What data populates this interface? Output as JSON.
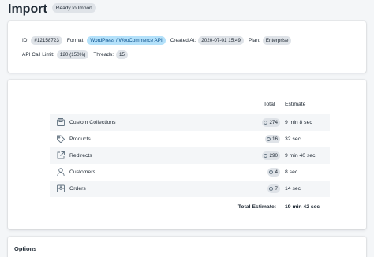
{
  "header": {
    "title": "Import",
    "status": "Ready to Import"
  },
  "info": {
    "id_label": "ID:",
    "id_value": "#12158723",
    "format_label": "Format:",
    "format_value": "WordPress / WooCommerce API",
    "created_label": "Created At:",
    "created_value": "2020-07-01 15:49",
    "plan_label": "Plan:",
    "plan_value": "Enterprise",
    "api_label": "API Call Limit:",
    "api_value": "120 (150%)",
    "threads_label": "Threads:",
    "threads_value": "15"
  },
  "table": {
    "col_total": "Total",
    "col_estimate": "Estimate",
    "rows": [
      {
        "label": "Custom Collections",
        "icon": "collection-icon",
        "total": "274",
        "estimate": "9 min 8 sec"
      },
      {
        "label": "Products",
        "icon": "tag-icon",
        "total": "16",
        "estimate": "32 sec"
      },
      {
        "label": "Redirects",
        "icon": "redirect-icon",
        "total": "290",
        "estimate": "9 min 40 sec"
      },
      {
        "label": "Customers",
        "icon": "customer-icon",
        "total": "4",
        "estimate": "8 sec"
      },
      {
        "label": "Orders",
        "icon": "order-icon",
        "total": "7",
        "estimate": "14 sec"
      }
    ],
    "total_label": "Total Estimate:",
    "total_value": "19 min 42 sec"
  },
  "options": {
    "title": "Options"
  }
}
